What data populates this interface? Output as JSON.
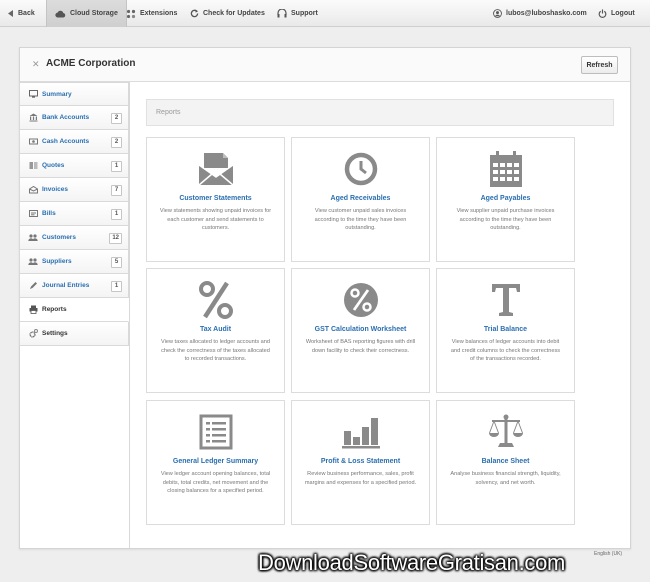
{
  "topbar": {
    "back": "Back",
    "cloud_storage": "Cloud Storage",
    "extensions": "Extensions",
    "check_updates": "Check for Updates",
    "support": "Support",
    "user": "lubos@luboshasko.com",
    "logout": "Logout"
  },
  "header": {
    "close": "✕",
    "company": "ACME Corporation",
    "refresh": "Refresh"
  },
  "sidebar": {
    "items": [
      {
        "label": "Summary",
        "count": "",
        "icon": "monitor-icon"
      },
      {
        "label": "Bank Accounts",
        "count": "2",
        "icon": "bank-icon"
      },
      {
        "label": "Cash Accounts",
        "count": "2",
        "icon": "cash-icon"
      },
      {
        "label": "Quotes",
        "count": "1",
        "icon": "quotes-icon"
      },
      {
        "label": "Invoices",
        "count": "7",
        "icon": "invoice-icon"
      },
      {
        "label": "Bills",
        "count": "1",
        "icon": "bill-icon"
      },
      {
        "label": "Customers",
        "count": "12",
        "icon": "customers-icon"
      },
      {
        "label": "Suppliers",
        "count": "5",
        "icon": "suppliers-icon"
      },
      {
        "label": "Journal Entries",
        "count": "1",
        "icon": "journal-icon"
      },
      {
        "label": "Reports",
        "count": "",
        "icon": "printer-icon"
      },
      {
        "label": "Settings",
        "count": "",
        "icon": "gear-icon"
      }
    ]
  },
  "reports_bar": "Reports",
  "cards": [
    {
      "title": "Customer Statements",
      "desc": "View statements showing unpaid invoices for each customer and send statements to customers.",
      "icon": "envelope-icon"
    },
    {
      "title": "Aged Receivables",
      "desc": "View customer unpaid sales invoices according to the time they have been outstanding.",
      "icon": "clock-icon"
    },
    {
      "title": "Aged Payables",
      "desc": "View supplier unpaid purchase invoices according to the time they have been outstanding.",
      "icon": "calendar-icon"
    },
    {
      "title": "Tax Audit",
      "desc": "View taxes allocated to ledger accounts and check the correctness of the taxes allocated to recorded transactions.",
      "icon": "percent-icon"
    },
    {
      "title": "GST Calculation Worksheet",
      "desc": "Worksheet of BAS reporting figures with drill down facility to check their correctness.",
      "icon": "percent-circle-icon"
    },
    {
      "title": "Trial Balance",
      "desc": "View balances of ledger accounts into debit and credit columns to check the correctness of the transactions recorded.",
      "icon": "t-letter-icon"
    },
    {
      "title": "General Ledger Summary",
      "desc": "View ledger account opening balances, total debits, total credits, net movement and the closing balances for a specified period.",
      "icon": "ledger-icon"
    },
    {
      "title": "Profit & Loss Statement",
      "desc": "Review business performance, sales, profit margins and expenses for a specified period.",
      "icon": "bar-chart-icon"
    },
    {
      "title": "Balance Sheet",
      "desc": "Analyse business financial strength, liquidity, solvency, and net worth.",
      "icon": "scales-icon"
    }
  ],
  "footer_lang": "English (UK)",
  "watermark": "DownloadSoftwareGratisan.com"
}
